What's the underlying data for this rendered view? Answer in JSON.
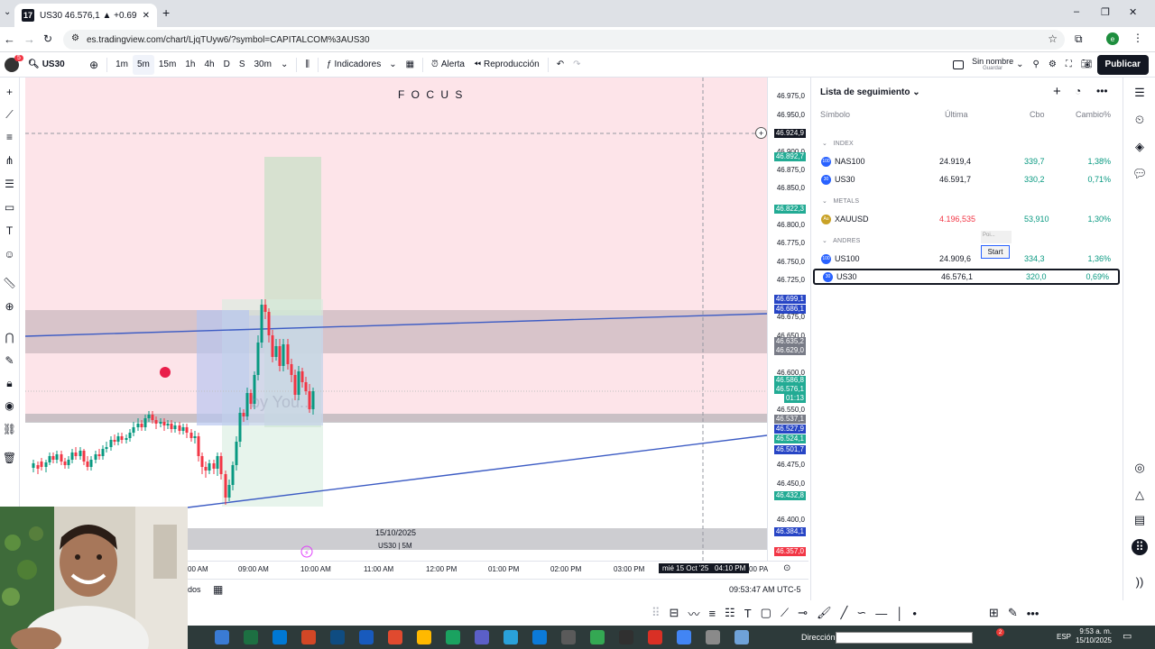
{
  "browser": {
    "tab_title": "US30 46.576,1 ▲ +0.69% Sin no",
    "url": "es.tradingview.com/chart/LjqTUyw6/?symbol=CAPITALCOM%3AUS30",
    "new_tab": "+",
    "window_controls": [
      "–",
      "❐",
      "✕"
    ],
    "profile_initial": "e"
  },
  "header": {
    "notif_count": "5",
    "symbol": "US30",
    "intervals": [
      "1m",
      "5m",
      "15m",
      "1h",
      "4h",
      "D",
      "S",
      "30m"
    ],
    "indicators": "Indicadores",
    "alert": "Alerta",
    "replay": "Reproducción",
    "layout_name": "Sin nombre",
    "layout_sub": "Guardar",
    "publish": "Publicar"
  },
  "chart": {
    "legend_count": "2",
    "focus_text": "F O C U S",
    "date_label": "15/10/2025",
    "symbol_label": "US30 | 5M",
    "watermark": "by You...",
    "cursor_price": "46.924,9",
    "price_ticks": [
      "46.975,0",
      "46.950,0",
      "46.900,0",
      "46.875,0",
      "46.850,0",
      "46.800,0",
      "46.775,0",
      "46.750,0",
      "46.725,0",
      "46.675,0",
      "46.650,0",
      "46.600,0",
      "46.550,0",
      "46.475,0",
      "46.450,0",
      "46.400,0"
    ],
    "price_tags": [
      {
        "text": "46.892,7",
        "color": "#22ab94"
      },
      {
        "text": "46.822,3",
        "color": "#22ab94"
      },
      {
        "text": "46.699,1",
        "color": "#2745c5"
      },
      {
        "text": "46.686,1",
        "color": "#2745c5"
      },
      {
        "text": "46.635,2",
        "color": "#787b86"
      },
      {
        "text": "46.629,0",
        "color": "#787b86"
      },
      {
        "text": "46.586,8",
        "color": "#22ab94"
      },
      {
        "text": "46.576,1",
        "color": "#22ab94"
      },
      {
        "text": "01:13",
        "color": "#22ab94"
      },
      {
        "text": "46.537,1",
        "color": "#787b86"
      },
      {
        "text": "46.527,9",
        "color": "#2745c5"
      },
      {
        "text": "46.524,1",
        "color": "#22ab94"
      },
      {
        "text": "46.501,7",
        "color": "#2745c5"
      },
      {
        "text": "46.432,8",
        "color": "#22ab94"
      },
      {
        "text": "46.384,1",
        "color": "#2745c5"
      },
      {
        "text": "46.357,0",
        "color": "#f23645"
      }
    ],
    "time_ticks": [
      "00 AM",
      "09:00 AM",
      "10:00 AM",
      "11:00 AM",
      "12:00 PM",
      "01:00 PM",
      "02:00 PM",
      "03:00 PM",
      "00 PA"
    ],
    "crosshair_time": "mié 15 Oct '25   04:10 PM",
    "clock": "09:53:47 AM UTC-5",
    "bottom_left": "dos"
  },
  "watchlist": {
    "title": "Lista de seguimiento",
    "columns": [
      "Símbolo",
      "Última",
      "Cbo",
      "Cambio%"
    ],
    "sections": [
      {
        "name": "INDEX",
        "rows": [
          {
            "symbol": "NAS100",
            "last": "24.919,4",
            "chg": "339,7",
            "pct": "1,38%",
            "icon": "100",
            "icon_color": "#2962ff"
          },
          {
            "symbol": "US30",
            "last": "46.591,7",
            "chg": "330,2",
            "pct": "0,71%",
            "icon": "30",
            "icon_color": "#2962ff"
          }
        ]
      },
      {
        "name": "METALS",
        "rows": [
          {
            "symbol": "XAUUSD",
            "last": "4.196,535",
            "chg": "53,910",
            "pct": "1,30%",
            "icon": "Au",
            "icon_color": "#c9a227"
          }
        ]
      },
      {
        "name": "ANDRES",
        "rows": [
          {
            "symbol": "US100",
            "last": "24.909,6",
            "chg": "334,3",
            "pct": "1,36%",
            "icon": "100",
            "icon_color": "#2962ff"
          },
          {
            "symbol": "US30",
            "last": "46.576,1",
            "chg": "320,0",
            "pct": "0,69%",
            "icon": "30",
            "icon_color": "#2962ff"
          }
        ]
      }
    ],
    "popup_small": "Poi...",
    "popup_button": "Start"
  },
  "taskbar": {
    "direction_label": "Dirección",
    "lang": "ESP",
    "time": "9:53 a. m.",
    "date": "15/10/2025",
    "badge": "2"
  },
  "colors": {
    "green": "#089981",
    "red": "#f23645",
    "blue": "#2962ff",
    "zone_pink": "#fce4ec"
  }
}
